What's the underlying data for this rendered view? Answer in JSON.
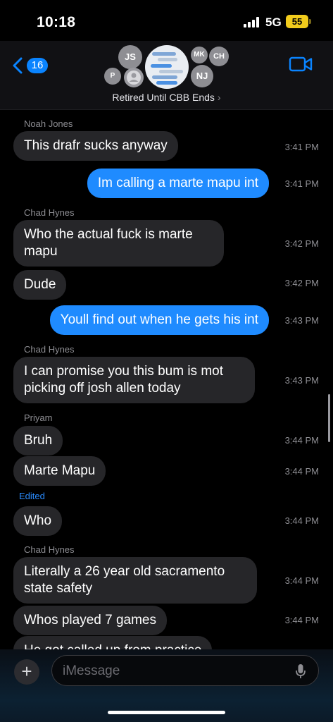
{
  "status_bar": {
    "time": "10:18",
    "network": "5G",
    "battery": "55"
  },
  "header": {
    "back_badge": "16",
    "group_name": "Retired Until CBB Ends",
    "chevron": "›",
    "avatars": [
      "JS",
      "P",
      "MK",
      "CH",
      "NJ"
    ]
  },
  "messages": [
    {
      "sender": "Noah Jones",
      "text": "This drafr sucks anyway",
      "time": "3:41 PM"
    },
    {
      "text": "Im calling a marte mapu int",
      "time": "3:41 PM"
    },
    {
      "sender": "Chad Hynes",
      "line1": "Who the actual fuck is marte",
      "line2": "mapu",
      "time": "3:42 PM"
    },
    {
      "text": "Dude",
      "time": "3:42 PM"
    },
    {
      "text": "Youll find out when he gets his int",
      "time": "3:43 PM"
    },
    {
      "sender": "Chad Hynes",
      "line1": "I can promise you this bum is mot",
      "line2": "picking off josh allen today",
      "time": "3:43 PM"
    },
    {
      "sender": "Priyam",
      "text": "Bruh",
      "time": "3:44 PM"
    },
    {
      "text": "Marte Mapu",
      "time": "3:44 PM"
    },
    {
      "edited": "Edited",
      "text": "Who",
      "time": "3:44 PM"
    },
    {
      "sender": "Chad Hynes",
      "line1": "Literally a 26 year old sacramento",
      "line2": "state safety",
      "time": "3:44 PM"
    },
    {
      "text": "Whos played 7 games",
      "time": "3:44 PM"
    },
    {
      "text": "He got called up from practice"
    }
  ],
  "input": {
    "plus": "+",
    "placeholder": "iMessage"
  },
  "colors": {
    "incoming": "#262629",
    "outgoing": "#1f8bff",
    "accent": "#0a84ff",
    "battery": "#f2cc1c"
  },
  "icons": [
    "back-chevron-icon",
    "video-camera-icon",
    "plus-icon",
    "microphone-icon",
    "signal-icon",
    "battery-icon",
    "person-icon"
  ]
}
